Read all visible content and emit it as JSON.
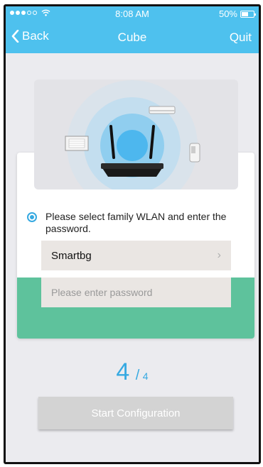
{
  "status_bar": {
    "time": "8:08 AM",
    "battery": "50%"
  },
  "nav": {
    "back_label": "Back",
    "title": "Cube",
    "quit_label": "Quit"
  },
  "form": {
    "instruction": "Please select family WLAN and enter the password.",
    "wlan_value": "Smartbg",
    "password_placeholder": "Please enter password"
  },
  "step": {
    "current": "4",
    "separator": "/",
    "total": "4"
  },
  "button": {
    "start_label": "Start Configuration"
  },
  "colors": {
    "accent": "#4ec1ee",
    "card_green": "#5ec29c",
    "step_blue": "#36a9e1"
  }
}
